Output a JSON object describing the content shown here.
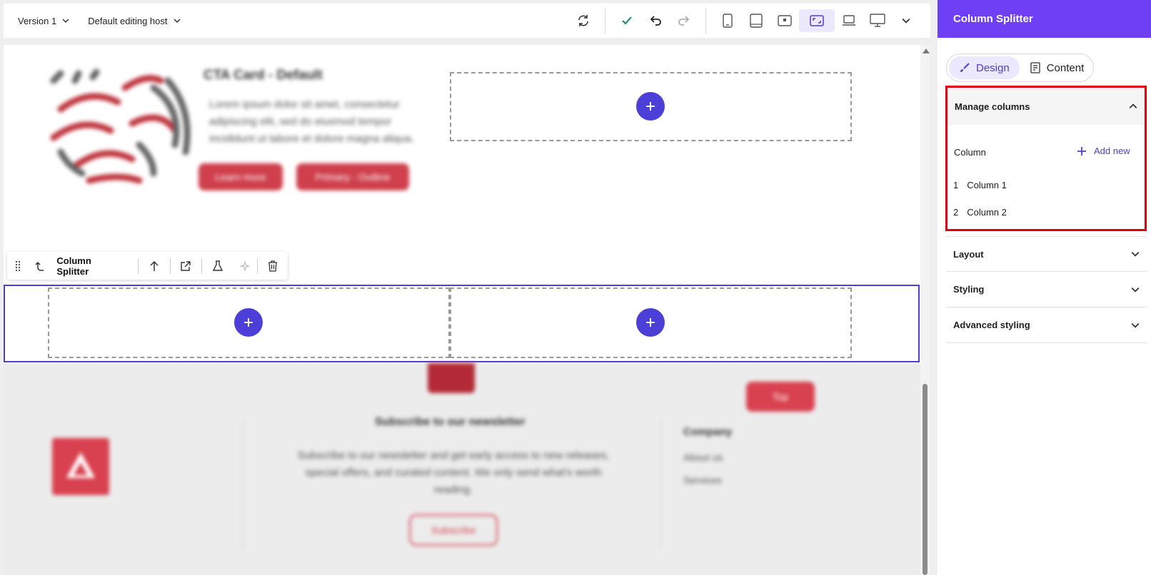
{
  "toolbar": {
    "version_label": "Version 1",
    "host_label": "Default editing host"
  },
  "canvas": {
    "cta_title": "CTA Card - Default",
    "cta_body": "Lorem ipsum dolor sit amet, consectetur adipiscing elit, sed do eiusmod tempor incididunt ut labore et dolore magna aliqua.",
    "cta_button_primary": "Learn more",
    "cta_button_secondary": "Primary - Outline",
    "component_toolbar_label": "Column Splitter",
    "footer": {
      "newsletter_title": "Subscribe to our newsletter",
      "newsletter_text": "Subscribe to our newsletter and get early access to new releases, special offers, and curated content. We only send what's worth reading.",
      "subscribe_label": "Subscribe",
      "top_label": "Top",
      "company_heading": "Company",
      "links": [
        "About us",
        "Services"
      ]
    }
  },
  "panel": {
    "title": "Column Splitter",
    "tabs": [
      {
        "label": "Design",
        "icon": "brush-icon",
        "active": true
      },
      {
        "label": "Content",
        "icon": "document-icon",
        "active": false
      }
    ],
    "manage_columns": {
      "title": "Manage columns",
      "column_heading": "Column",
      "add_new_label": "Add new",
      "columns": [
        {
          "index": "1",
          "name": "Column 1"
        },
        {
          "index": "2",
          "name": "Column 2"
        }
      ]
    },
    "sections": [
      {
        "title": "Layout"
      },
      {
        "title": "Styling"
      },
      {
        "title": "Advanced styling"
      }
    ]
  },
  "colors": {
    "accent": "#4b3fd8",
    "header_purple": "#6e3ff5",
    "highlight_red": "#e1000f",
    "brand_red": "#d8414f"
  }
}
